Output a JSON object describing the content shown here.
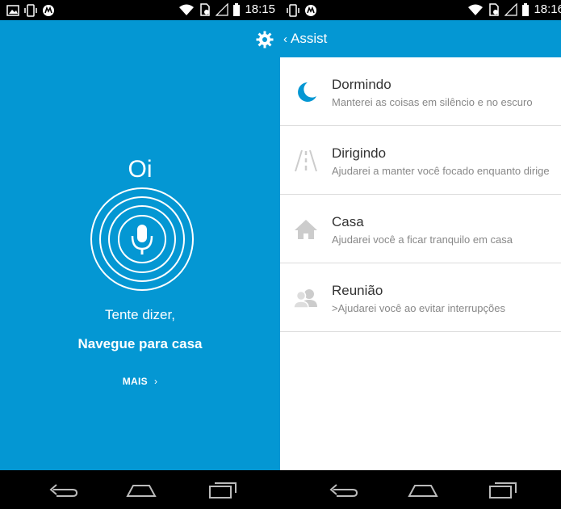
{
  "status_bar_left": {
    "time": "18:15"
  },
  "status_bar_right": {
    "time": "18:16"
  },
  "left_screen": {
    "greeting": "Oi",
    "try_label": "Tente dizer,",
    "try_command": "Navegue para casa",
    "more_label": "MAIS",
    "accent_color": "#0497d3"
  },
  "right_screen": {
    "title": "Assist",
    "items": [
      {
        "title": "Dormindo",
        "subtitle": "Manterei as coisas em silêncio e no escuro",
        "icon": "moon-icon"
      },
      {
        "title": "Dirigindo",
        "subtitle": "Ajudarei a manter você focado enquanto dirige",
        "icon": "road-icon"
      },
      {
        "title": "Casa",
        "subtitle": "Ajudarei você a ficar tranquilo em casa",
        "icon": "home-icon"
      },
      {
        "title": "Reunião",
        "subtitle": ">Ajudarei você ao evitar interrupções",
        "icon": "people-icon"
      }
    ]
  }
}
